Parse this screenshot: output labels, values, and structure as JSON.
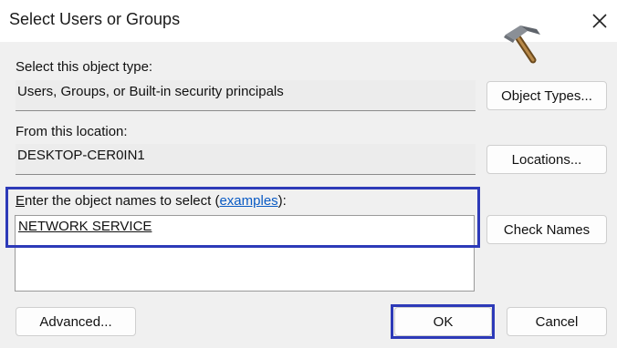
{
  "dialog": {
    "title": "Select Users or Groups",
    "close_icon": "close-icon",
    "logo_icon": "hammer-icon"
  },
  "object_type": {
    "label": "Select this object type:",
    "value": "Users, Groups, or Built-in security principals",
    "button": "Object Types..."
  },
  "location": {
    "label": "From this location:",
    "value": "DESKTOP-CER0IN1",
    "button": "Locations..."
  },
  "names": {
    "label_prefix_accel": "E",
    "label_prefix_rest": "nter the object names to select (",
    "label_link": "examples",
    "label_suffix": "):",
    "value": "NETWORK SERVICE",
    "check_button": "Check Names"
  },
  "footer": {
    "advanced_button": "Advanced...",
    "ok_button": "OK",
    "cancel_button": "Cancel"
  },
  "colors": {
    "highlight": "#2d3ab8",
    "link": "#0a5bc4",
    "dialog_bg": "#f0f0f0"
  }
}
